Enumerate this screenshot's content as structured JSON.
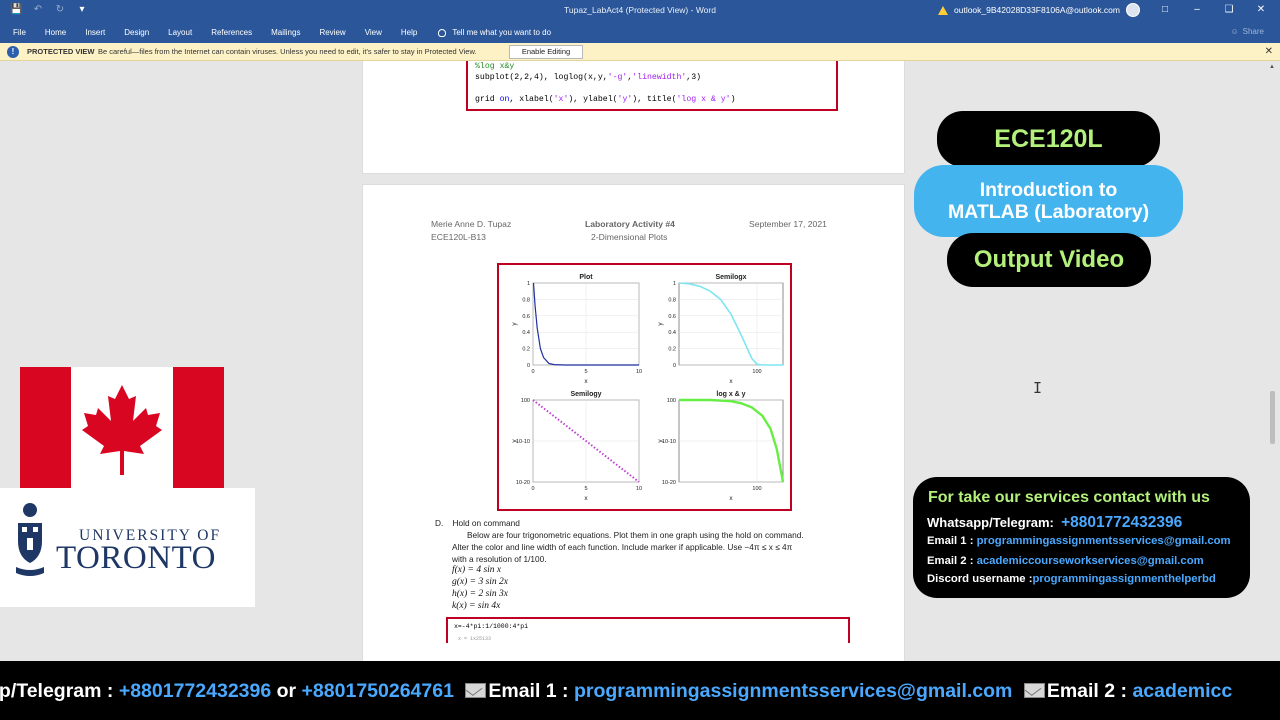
{
  "window": {
    "title": "Tupaz_LabAct4 (Protected View)  -  Word",
    "account": "outlook_9B42028D33F8106A@outlook.com"
  },
  "ribbon": {
    "tabs": [
      "File",
      "Home",
      "Insert",
      "Design",
      "Layout",
      "References",
      "Mailings",
      "Review",
      "View",
      "Help"
    ],
    "tell_me": "Tell me what you want to do",
    "share": "Share"
  },
  "protected_view": {
    "label": "PROTECTED VIEW",
    "message": "Be careful—files from the Internet can contain viruses. Unless you need to edit, it's safer to stay in Protected View.",
    "button": "Enable Editing"
  },
  "page1_code": {
    "line1": "%log x&y",
    "line2a": "subplot(2,2,4), loglog(x,y,",
    "line2s1": "'-g'",
    "line2b": ",",
    "line2s2": "'linewidth'",
    "line2c": ",3)",
    "line4a": "grid ",
    "line4kw": "on",
    "line4b": ", xlabel(",
    "line4s1": "'x'",
    "line4c": "), ylabel(",
    "line4s2": "'y'",
    "line4d": "), title(",
    "line4s3": "'log x & y'",
    "line4e": ")"
  },
  "page2_header": {
    "author": "Merie Anne D. Tupaz",
    "course": "ECE120L-B13",
    "activity": "Laboratory Activity #4",
    "topic": "2-Dimensional Plots",
    "date": "September 17, 2021"
  },
  "section_d": {
    "label": "D.",
    "title": "Hold on command",
    "para1": "Below are four trigonometric equations. Plot them in one graph using the hold on command.",
    "para2": "Alter the color and line width of each function. Include marker if applicable. Use −4π ≤ x ≤ 4π",
    "para3": "with a resolution of 1/100.",
    "equations": [
      "f(x) = 4 sin x",
      "g(x) = 3 sin 2x",
      "h(x) = 2 sin 3x",
      "k(x) = sin 4x"
    ],
    "code_line": "x=-4*pi:1/1000:4*pi",
    "code_sub": "x = 1x25133"
  },
  "overlay": {
    "course_code": "ECE120L",
    "course_name_1": "Introduction to",
    "course_name_2": "MATLAB (Laboratory)",
    "output": "Output Video",
    "uoft_1": "UNIVERSITY OF",
    "uoft_2": "TORONTO"
  },
  "contact": {
    "title": "For take our services contact with us",
    "wa_label": "Whatsapp/Telegram:",
    "wa_value": "+8801772432396",
    "email1_label": "Email 1 :",
    "email1_value": "programmingassignmentsservices@gmail.com",
    "email2_label": "Email 2 :",
    "email2_value": "academiccourseworkservices@gmail.com",
    "discord_label": "Discord username :",
    "discord_value": "programmingassignmenthelperbd"
  },
  "ticker": {
    "part1": "pp/Telegram : ",
    "phone1": "+8801772432396",
    "or": " or ",
    "phone2": "+8801750264761",
    "email1_label": "Email 1 : ",
    "email1": "programmingassignmentsservices@gmail.com",
    "email2_label": "Email 2 : ",
    "email2": "academicc"
  },
  "chart_data": [
    {
      "type": "line",
      "title": "Plot",
      "xlabel": "x",
      "ylabel": "y",
      "xlim": [
        0,
        10
      ],
      "ylim": [
        0,
        1
      ],
      "x_ticks": [
        "0",
        "5",
        "10"
      ],
      "y_ticks": [
        "0",
        "0.2",
        "0.4",
        "0.6",
        "0.8",
        "1"
      ],
      "grid": true,
      "color": "#1f2f9f",
      "x": [
        0.05,
        0.2,
        0.4,
        0.7,
        1.0,
        1.5,
        2.0,
        3.0,
        10
      ],
      "y": [
        1.0,
        0.72,
        0.45,
        0.2,
        0.09,
        0.02,
        0.005,
        0.0,
        0.0
      ]
    },
    {
      "type": "line",
      "title": "Semilogx",
      "xlabel": "x",
      "ylabel": "y",
      "x_scale": "log",
      "ylim": [
        0,
        1
      ],
      "x_ticks": [
        "10^0"
      ],
      "y_ticks": [
        "0",
        "0.2",
        "0.4",
        "0.6",
        "0.8",
        "1"
      ],
      "grid": true,
      "color": "#7ee6f0",
      "x_frac": [
        0,
        0.1,
        0.2,
        0.3,
        0.4,
        0.5,
        0.6,
        0.65,
        0.7,
        0.75,
        0.8,
        1.0
      ],
      "y": [
        1.0,
        0.99,
        0.96,
        0.9,
        0.8,
        0.62,
        0.36,
        0.22,
        0.08,
        0.01,
        0.0,
        0.0
      ]
    },
    {
      "type": "line",
      "title": "Semilogy",
      "xlabel": "x",
      "ylabel": "y",
      "xlim": [
        0,
        10
      ],
      "y_scale": "log",
      "x_ticks": [
        "0",
        "5",
        "10"
      ],
      "y_ticks": [
        "10^0",
        "10^-10",
        "10^-20"
      ],
      "grid": true,
      "color": "#c040d0",
      "style": "dotted",
      "x": [
        0,
        10
      ],
      "y_exp": [
        0,
        -20
      ]
    },
    {
      "type": "line",
      "title": "log x & y",
      "xlabel": "x",
      "ylabel": "y",
      "x_scale": "log",
      "y_scale": "log",
      "x_ticks": [
        "10^0"
      ],
      "y_ticks": [
        "10^0",
        "10^-10",
        "10^-20"
      ],
      "grid": true,
      "color": "#66ee44",
      "x_frac": [
        0,
        0.3,
        0.5,
        0.6,
        0.7,
        0.8,
        0.88,
        0.94,
        1.0
      ],
      "y_exp": [
        0,
        0,
        -0.3,
        -0.8,
        -1.8,
        -3.8,
        -7,
        -12,
        -20
      ]
    }
  ]
}
